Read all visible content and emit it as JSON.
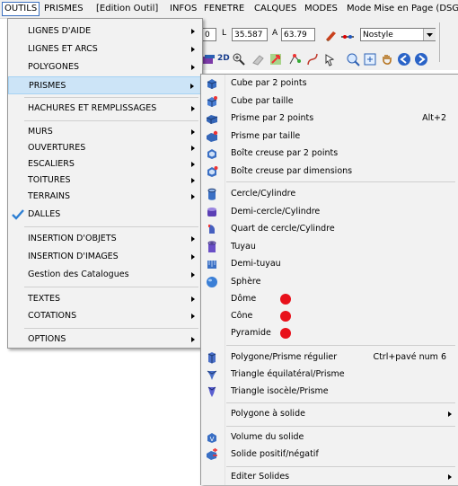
{
  "menubar": {
    "items": [
      "OUTILS",
      "PRISMES",
      "[Edition Outil]",
      "INFOS",
      "FENETRE",
      "CALQUES",
      "MODES",
      "Mode Mise en Page (DSG)"
    ]
  },
  "toolbar": {
    "field0": "0",
    "l_label": "L",
    "l_value": "35.587",
    "a_label": "A",
    "a_value": "63.79",
    "style_value": "Nostyle",
    "mode_2d": "2D"
  },
  "outils_menu": {
    "items": [
      {
        "label": "LIGNES D'AIDE",
        "submenu": true
      },
      {
        "label": "LIGNES ET ARCS",
        "submenu": true
      },
      {
        "label": "POLYGONES",
        "submenu": true
      },
      {
        "label": "PRISMES",
        "submenu": true,
        "highlighted": true
      },
      {
        "label": "HACHURES ET REMPLISSAGES",
        "submenu": true
      },
      {
        "label": "MURS",
        "submenu": true
      },
      {
        "label": "OUVERTURES",
        "submenu": true
      },
      {
        "label": "ESCALIERS",
        "submenu": true
      },
      {
        "label": "TOITURES",
        "submenu": true
      },
      {
        "label": "TERRAINS",
        "submenu": true
      },
      {
        "label": "DALLES",
        "submenu": false,
        "icon": "dalles-check-icon"
      },
      {
        "label": "INSERTION D'OBJETS",
        "submenu": true
      },
      {
        "label": "INSERTION D'IMAGES",
        "submenu": true
      },
      {
        "label": "Gestion des Catalogues",
        "submenu": true
      },
      {
        "label": "TEXTES",
        "submenu": true
      },
      {
        "label": "COTATIONS",
        "submenu": true
      },
      {
        "label": "OPTIONS",
        "submenu": true
      }
    ]
  },
  "prismes_menu": {
    "items": [
      {
        "label": "Cube par 2 points",
        "icon": "cube-2pts-icon"
      },
      {
        "label": "Cube par taille",
        "icon": "cube-size-icon"
      },
      {
        "label": "Prisme par 2 points",
        "icon": "prism-2pts-icon",
        "shortcut": "Alt+2"
      },
      {
        "label": "Prisme par taille",
        "icon": "prism-size-icon"
      },
      {
        "label": "Boîte creuse par 2 points",
        "icon": "hollow-box-2pts-icon"
      },
      {
        "label": "Boîte creuse par dimensions",
        "icon": "hollow-box-dims-icon"
      },
      {
        "label": "Cercle/Cylindre",
        "icon": "cylinder-icon"
      },
      {
        "label": "Demi-cercle/Cylindre",
        "icon": "half-cylinder-icon"
      },
      {
        "label": "Quart de cercle/Cylindre",
        "icon": "quarter-cylinder-icon"
      },
      {
        "label": "Tuyau",
        "icon": "pipe-icon"
      },
      {
        "label": "Demi-tuyau",
        "icon": "half-pipe-icon"
      },
      {
        "label": "Sphère",
        "icon": "sphere-icon"
      },
      {
        "label": "Dôme",
        "marker": "red-dot"
      },
      {
        "label": "Cône",
        "marker": "red-dot"
      },
      {
        "label": "Pyramide",
        "marker": "red-dot"
      },
      {
        "label": "Polygone/Prisme régulier",
        "icon": "regular-prism-icon",
        "shortcut": "Ctrl+pavé num 6"
      },
      {
        "label": "Triangle équilatéral/Prisme",
        "icon": "equilateral-prism-icon"
      },
      {
        "label": "Triangle isocèle/Prisme",
        "icon": "isosceles-prism-icon"
      },
      {
        "label": "Polygone à solide",
        "submenu": true
      },
      {
        "label": "Volume du solide",
        "icon": "volume-icon"
      },
      {
        "label": "Solide positif/négatif",
        "icon": "solid-posneg-icon"
      },
      {
        "label": "Editer Solides",
        "submenu": true
      }
    ]
  },
  "colors": {
    "highlight": "#cce4f7",
    "menu_bg": "#f2f2f2",
    "marker": "#e8111b"
  }
}
